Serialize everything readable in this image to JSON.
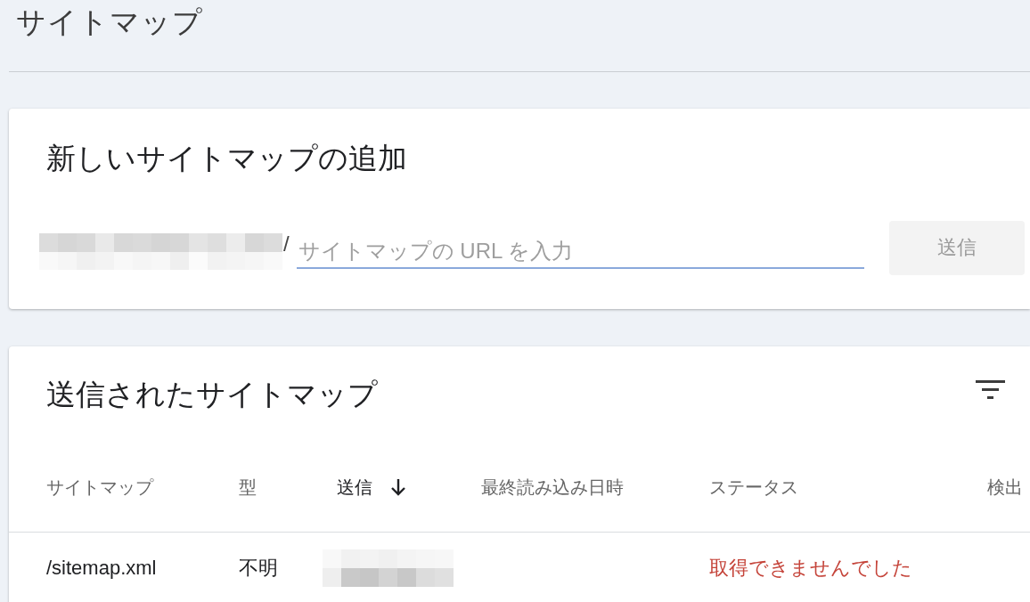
{
  "page": {
    "title": "サイトマップ"
  },
  "add_card": {
    "title": "新しいサイトマップの追加",
    "domain_redacted": true,
    "separator": "/",
    "url_field": {
      "placeholder": "サイトマップの URL を入力"
    },
    "submit_button": {
      "label": "送信",
      "disabled": true
    }
  },
  "submitted_card": {
    "title": "送信されたサイトマップ",
    "columns": [
      {
        "label": "サイトマップ",
        "sorted": false
      },
      {
        "label": "型",
        "sorted": false
      },
      {
        "label": "送信",
        "sorted": true
      },
      {
        "label": "最終読み込み日時",
        "sorted": false
      },
      {
        "label": "ステータス",
        "sorted": false
      },
      {
        "label": "検出",
        "sorted": false
      }
    ],
    "rows": [
      {
        "sitemap": "/sitemap.xml",
        "type": "不明",
        "submitted_redacted": true,
        "status": "取得できませんでした",
        "error": true
      }
    ]
  }
}
